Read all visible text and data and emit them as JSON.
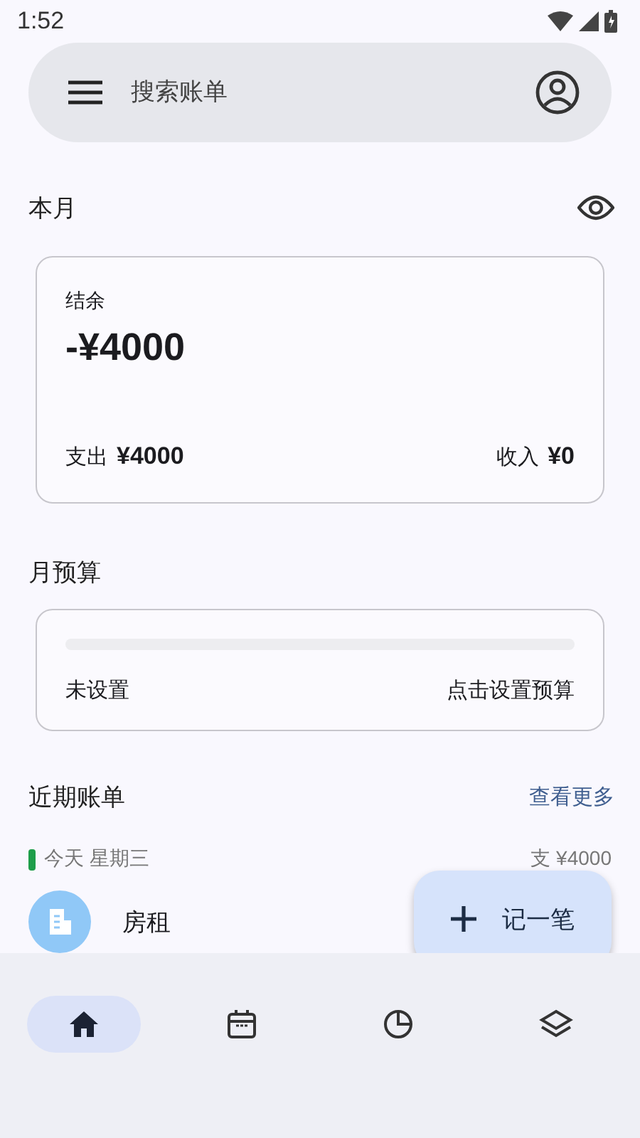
{
  "status_bar": {
    "time": "1:52"
  },
  "search": {
    "placeholder": "搜索账单"
  },
  "month": {
    "title": "本月",
    "balance_label": "结余",
    "balance": "-¥4000",
    "expense_label": "支出",
    "expense": "¥4000",
    "income_label": "收入",
    "income": "¥0"
  },
  "budget": {
    "title": "月预算",
    "level": 0,
    "status": "未设置",
    "action": "点击设置预算"
  },
  "recent": {
    "title": "近期账单",
    "more": "查看更多",
    "days": [
      {
        "date": "今天 星期三",
        "color": "#1e9e4a",
        "total": "支 ¥4000",
        "entries": [
          {
            "name": "房租"
          }
        ]
      }
    ]
  },
  "fab": {
    "label": "记一笔"
  },
  "nav": [
    {
      "kind": "home",
      "selected": true
    },
    {
      "kind": "calendar",
      "selected": false
    },
    {
      "kind": "chart",
      "selected": false
    },
    {
      "kind": "layers",
      "selected": false
    }
  ]
}
